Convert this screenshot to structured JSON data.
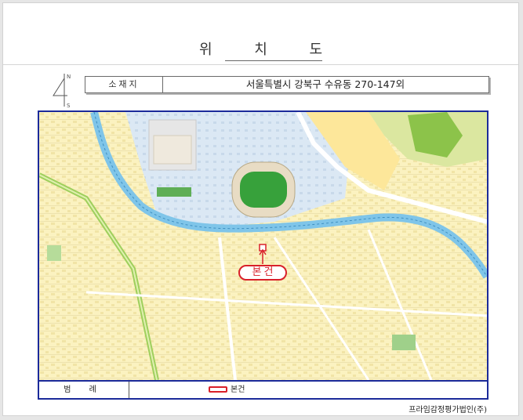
{
  "title": "위 치 도",
  "north_marker": {
    "letter_n": "N",
    "letter_s": "S"
  },
  "location": {
    "label": "소재지",
    "value": "서울특별시 강북구 수유동 270-147외"
  },
  "map": {
    "subject_label": "본건",
    "colors": {
      "frame": "#1b2a9a",
      "river": "#7fc5e9",
      "stadium_field": "#37a13b",
      "park": "#8cc34a",
      "subject": "#d9202a"
    }
  },
  "legend": {
    "label": "범 례",
    "subject_item": "본건"
  },
  "footer": {
    "company": "프라임감정평가법인(주)"
  }
}
